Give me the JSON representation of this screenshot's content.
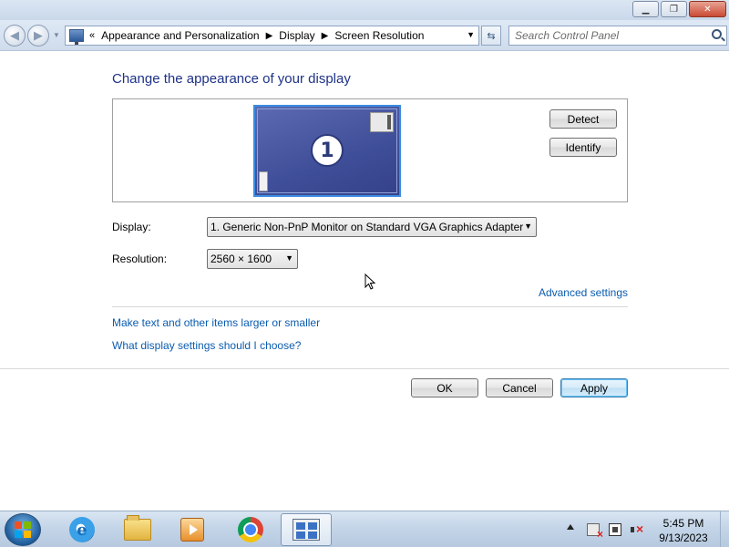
{
  "window": {
    "minimize_symbol": "▁",
    "maximize_symbol": "❐",
    "close_symbol": "✕"
  },
  "navigation": {
    "back_symbol": "◀",
    "forward_symbol": "▶",
    "breadcrumb_overflow": "«",
    "breadcrumbs": [
      "Appearance and Personalization",
      "Display",
      "Screen Resolution"
    ],
    "separator": "▶",
    "refresh_symbol": "⇆"
  },
  "search": {
    "placeholder": "Search Control Panel",
    "value": ""
  },
  "main": {
    "title": "Change the appearance of your display",
    "monitor_number": "1",
    "detect_label": "Detect",
    "identify_label": "Identify",
    "display_label": "Display:",
    "display_value": "1. Generic Non-PnP Monitor on Standard VGA Graphics Adapter",
    "resolution_label": "Resolution:",
    "resolution_value": "2560 × 1600",
    "advanced_settings_link": "Advanced settings",
    "larger_text_link": "Make text and other items larger or smaller",
    "help_link": "What display settings should I choose?"
  },
  "dialog_buttons": {
    "ok": "OK",
    "cancel": "Cancel",
    "apply": "Apply"
  },
  "taskbar": {
    "pinned": [
      "internet-explorer-icon",
      "windows-explorer-icon",
      "media-player-icon",
      "chrome-icon",
      "display-control-panel-icon"
    ],
    "clock_time": "5:45 PM",
    "clock_date": "9/13/2023"
  },
  "colors": {
    "title_blue": "#1e3287",
    "link_blue": "#0a5cb0",
    "apply_accent": "#3c7fb1"
  }
}
